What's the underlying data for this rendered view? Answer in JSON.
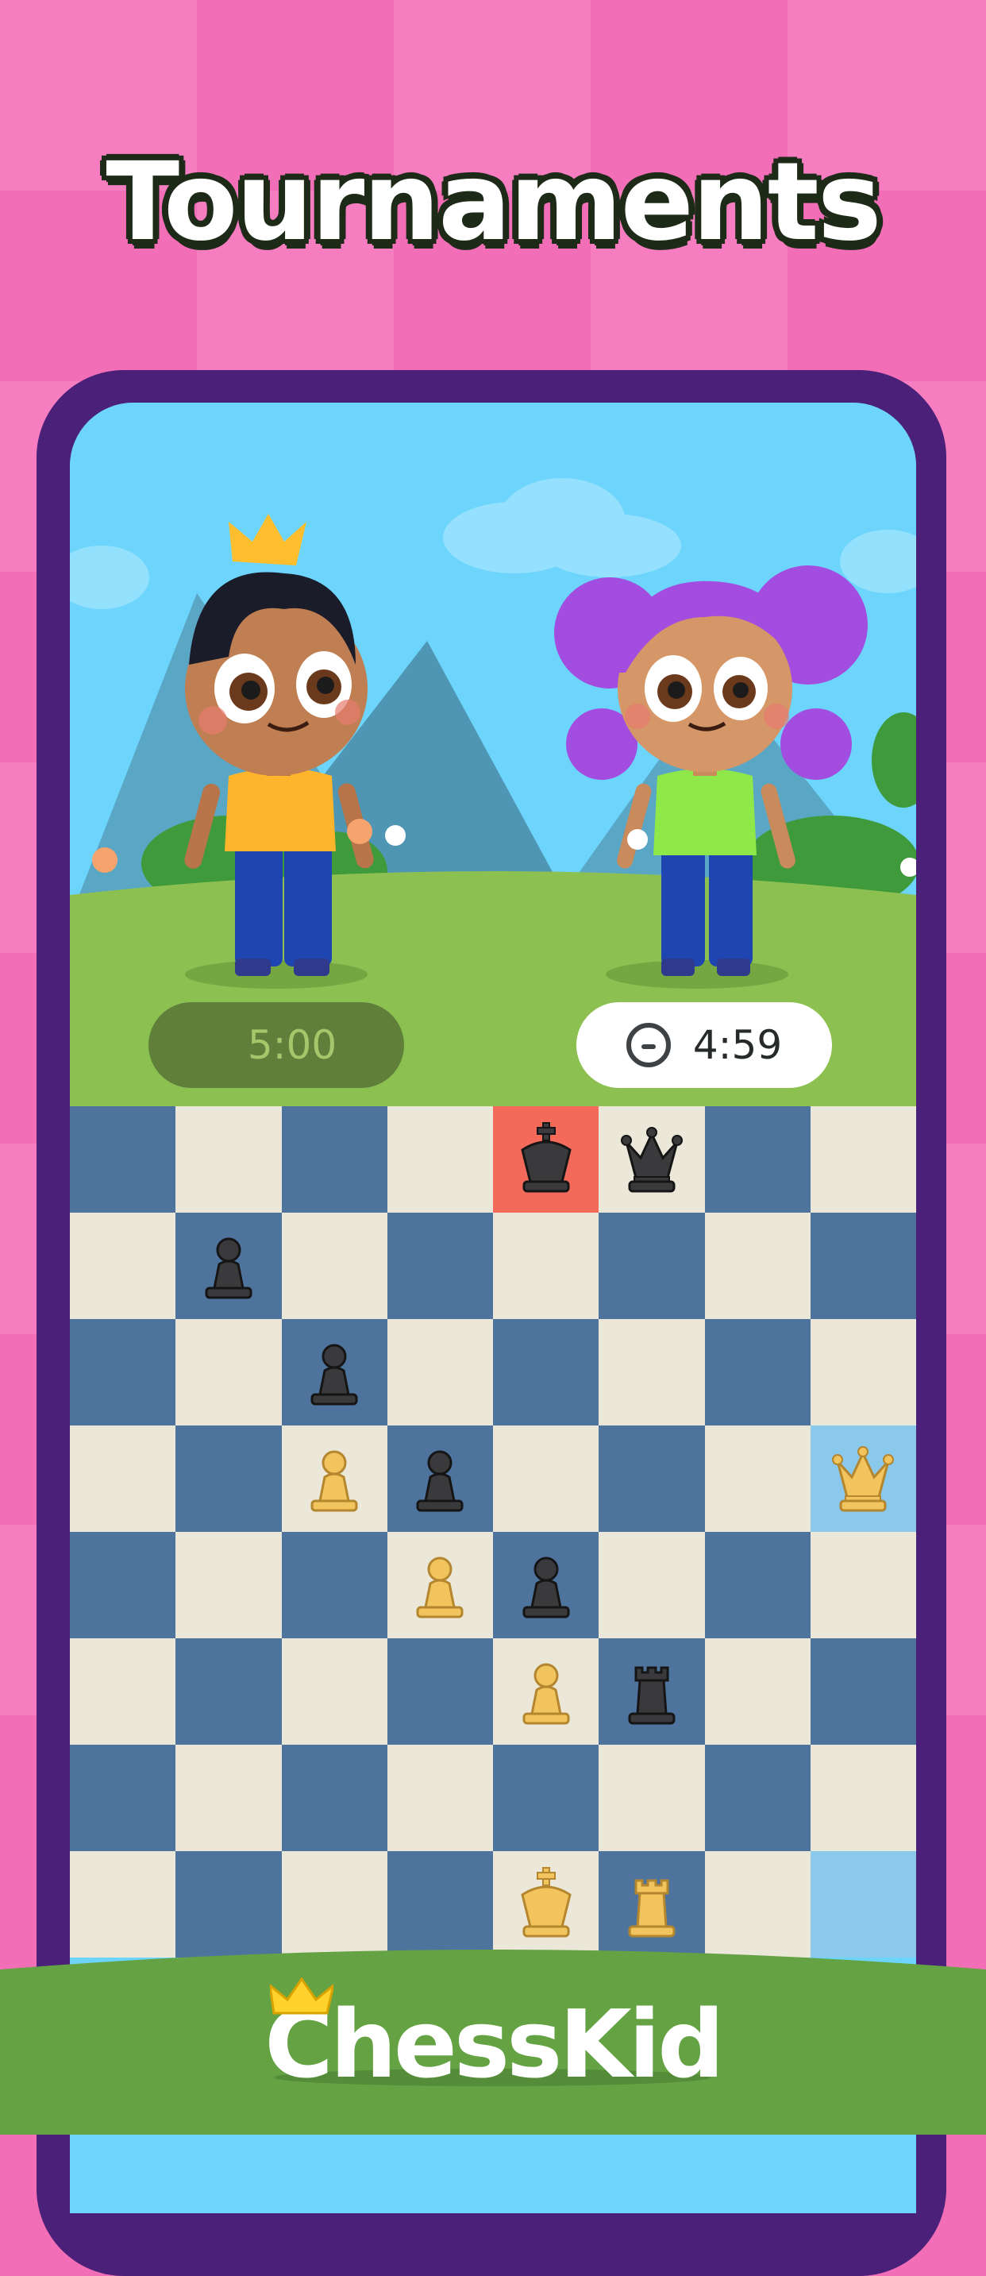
{
  "headline": "Tournaments",
  "clocks": {
    "player_left_time": "5:00",
    "player_right_time": "4:59",
    "player_right_icon": "minus-circle-icon"
  },
  "brand": {
    "name": "ChessKid",
    "logo_icon": "crown-icon"
  },
  "colors": {
    "background_pink": "#f26fb7",
    "phone_frame": "#4a2079",
    "sky": "#6dd4fb",
    "grass": "#8cc152",
    "board_light": "#ebe8d9",
    "board_dark": "#4e739c",
    "check_square": "#f36a5a",
    "last_move_square": "#8ac9ec",
    "footer_green": "#64a244"
  },
  "characters": [
    {
      "name": "boy-with-crown-avatar",
      "shirt": "#ffb52b"
    },
    {
      "name": "girl-purple-hair-avatar",
      "shirt": "#8fe84a"
    }
  ],
  "board": {
    "pieces": [
      {
        "square": "e8",
        "piece": "king",
        "color": "black",
        "in_check": true
      },
      {
        "square": "f8",
        "piece": "queen",
        "color": "black"
      },
      {
        "square": "b7",
        "piece": "pawn",
        "color": "black"
      },
      {
        "square": "c6",
        "piece": "pawn",
        "color": "black"
      },
      {
        "square": "c5",
        "piece": "pawn",
        "color": "white"
      },
      {
        "square": "d5",
        "piece": "pawn",
        "color": "black"
      },
      {
        "square": "h5",
        "piece": "queen",
        "color": "white",
        "highlighted": true
      },
      {
        "square": "d4",
        "piece": "pawn",
        "color": "white"
      },
      {
        "square": "e4",
        "piece": "pawn",
        "color": "black"
      },
      {
        "square": "e3",
        "piece": "pawn",
        "color": "white"
      },
      {
        "square": "f3",
        "piece": "rook",
        "color": "black"
      },
      {
        "square": "e1",
        "piece": "king",
        "color": "white"
      },
      {
        "square": "f1",
        "piece": "rook",
        "color": "white"
      }
    ],
    "highlighted_squares": [
      "h5",
      "h1"
    ]
  }
}
